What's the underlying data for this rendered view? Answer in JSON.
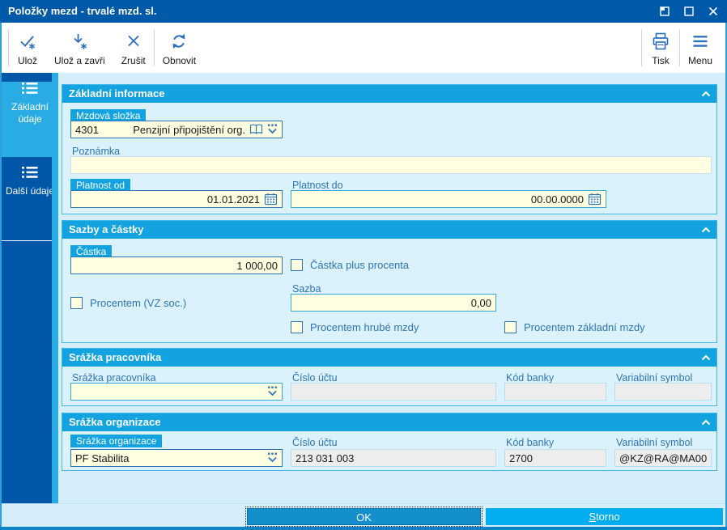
{
  "window": {
    "title": "Položky mezd - trvalé mzd. sl."
  },
  "toolbar": {
    "save": "Ulož",
    "save_close": "Ulož a zavři",
    "cancel": "Zrušit",
    "refresh": "Obnovit",
    "print": "Tisk",
    "menu": "Menu"
  },
  "sidebar": {
    "tab_basic": "Základní údaje",
    "tab_more": "Další údaje"
  },
  "basic": {
    "title": "Základní informace",
    "mzdova_slozka": {
      "label": "Mzdová složka",
      "code": "4301",
      "name": "Penzijní připojištění org."
    },
    "poznamka": {
      "label": "Poznámka",
      "value": ""
    },
    "platnost_od": {
      "label": "Platnost od",
      "value": "01.01.2021"
    },
    "platnost_do": {
      "label": "Platnost do",
      "value": "00.00.0000"
    }
  },
  "rates": {
    "title": "Sazby a částky",
    "castka": {
      "label": "Částka",
      "value": "1 000,00"
    },
    "castka_plus": {
      "label": "Částka plus procenta",
      "checked": false
    },
    "procentem_vz": {
      "label": "Procentem (VZ soc.)",
      "checked": false
    },
    "sazba": {
      "label": "Sazba",
      "value": "0,00"
    },
    "procentem_hrube": {
      "label": "Procentem hrubé mzdy",
      "checked": false
    },
    "procentem_zakladni": {
      "label": "Procentem základní mzdy",
      "checked": false
    }
  },
  "worker": {
    "title": "Srážka pracovníka",
    "srazka": {
      "label": "Srážka pracovníka",
      "value": ""
    },
    "ucet": {
      "label": "Číslo účtu",
      "value": ""
    },
    "banka": {
      "label": "Kód banky",
      "value": ""
    },
    "vs": {
      "label": "Variabilní symbol",
      "value": ""
    }
  },
  "org": {
    "title": "Srážka organizace",
    "srazka": {
      "label": "Srážka organizace",
      "value": "PF Stabilita"
    },
    "ucet": {
      "label": "Číslo účtu",
      "value": "213 031 003"
    },
    "banka": {
      "label": "Kód banky",
      "value": "2700"
    },
    "vs": {
      "label": "Variabilní symbol",
      "value": "@KZ@RA@MA00"
    }
  },
  "footer": {
    "ok": "OK",
    "storno": "Storno"
  },
  "colors": {
    "titlebar": "#0059A9",
    "sidebar_dark": "#0057A8",
    "accent_cyan": "#29ACE3",
    "section_header": "#12A3E0",
    "main_bg": "#D5EEF9",
    "input_yellow": "#FFFFE1",
    "input_disabled": "#EDEDED",
    "label_blue": "#2E75B5",
    "ok_button": "#1390CC",
    "storno_button": "#00AEEF"
  },
  "icons": {
    "save-icon": "check+asterisk",
    "save-close-icon": "arrow-down+asterisk",
    "cancel-icon": "✕",
    "refresh-icon": "⟳",
    "print-icon": "printer",
    "menu-icon": "≡",
    "list-icon": "≣",
    "book-icon": "open-book",
    "dropdown-icon": "dots+chevron-down",
    "calendar-icon": "calendar-grid",
    "collapse-icon": "^",
    "float-icon": "window-float",
    "maximize-icon": "□",
    "close-icon": "✕"
  }
}
